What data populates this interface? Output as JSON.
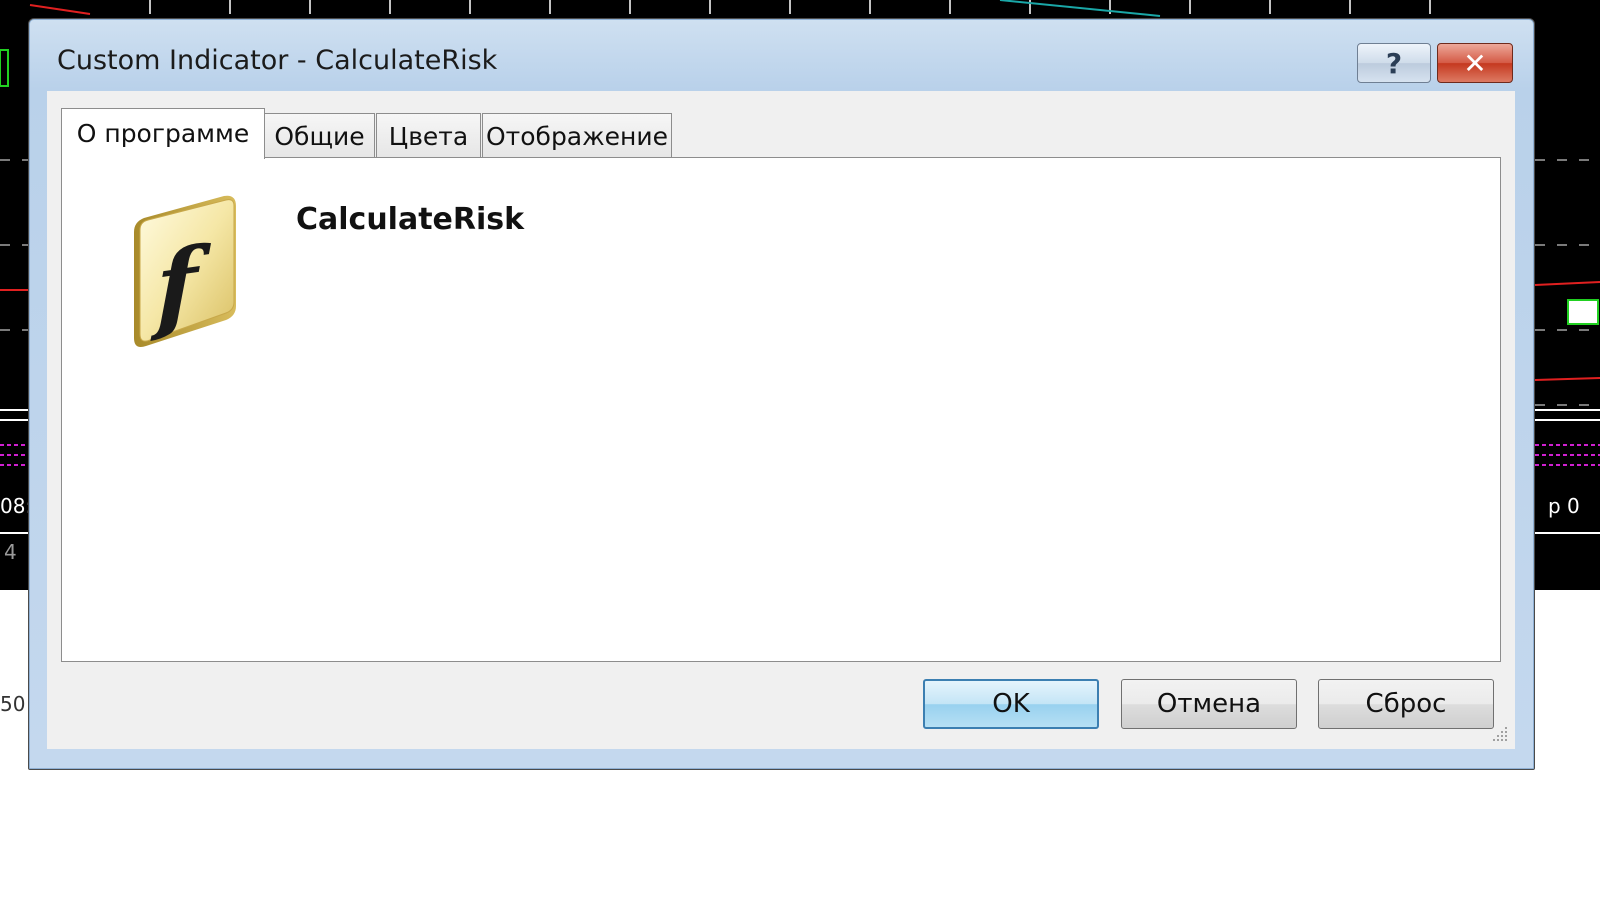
{
  "window": {
    "title": "Custom Indicator - CalculateRisk",
    "help_glyph": "?",
    "close_glyph": "✕"
  },
  "tabs": [
    {
      "label": "О программе",
      "active": true
    },
    {
      "label": "Общие",
      "active": false
    },
    {
      "label": "Цвета",
      "active": false
    },
    {
      "label": "Отображение",
      "active": false
    }
  ],
  "about": {
    "icon": "function-icon",
    "program_name": "CalculateRisk"
  },
  "buttons": {
    "ok": "OK",
    "cancel": "Отмена",
    "reset": "Сброс"
  },
  "background": {
    "left_time_fragment": "08:",
    "left_number_fragment": "4",
    "left_lower_fragment": "50",
    "right_time_fragment": "р 0"
  },
  "colors": {
    "title_bar": "#b9d1ea",
    "close_button": "#c4381f",
    "ok_button": "#98d1ef",
    "chart_background": "#000000"
  }
}
